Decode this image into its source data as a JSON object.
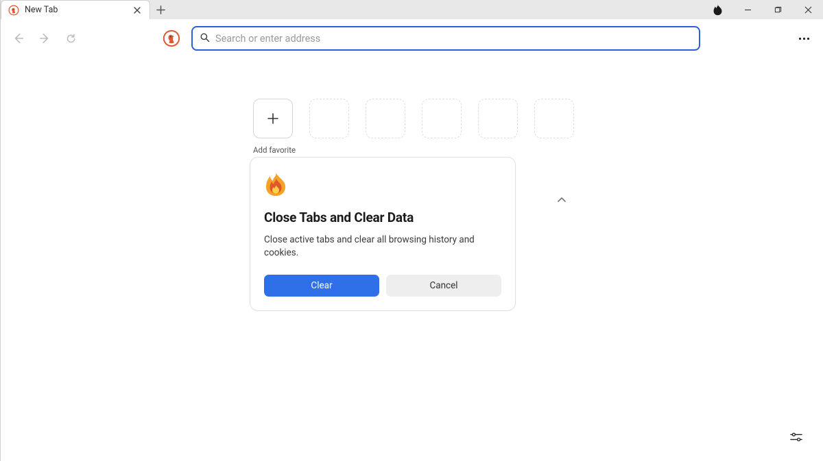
{
  "tab": {
    "title": "New Tab"
  },
  "address": {
    "placeholder": "Search or enter address"
  },
  "favorites": {
    "add_label": "Add favorite",
    "empty_slots": 5
  },
  "dialog": {
    "title": "Close Tabs and Clear Data",
    "body": "Close active tabs and clear all browsing history and cookies.",
    "primary": "Clear",
    "secondary": "Cancel"
  },
  "colors": {
    "accent": "#2f6fe8",
    "address_border": "#2b5fd9"
  }
}
